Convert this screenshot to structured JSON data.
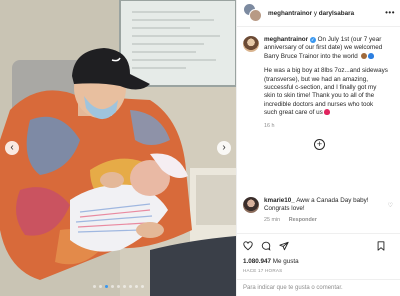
{
  "header": {
    "author1": "meghantrainor",
    "joiner": " y ",
    "author2": "darylsabara",
    "more_icon": "more-horizontal-icon"
  },
  "caption": {
    "username": "meghantrainor",
    "text1": " On July 1st (our 7 year anniversary of our first date) we welcomed Barry Bruce Trainor into the world ",
    "text2": "He was a big boy at 8lbs 7oz...and sideways (transverse), but we had an amazing, successful c-section, and I finally got my skin to skin time! Thank you to all of the incredible doctors and nurses who took such great care of us",
    "time": "16 h",
    "verified_icon": "verified-badge-icon"
  },
  "comment": {
    "username": "kmarie10_",
    "text": " Aww a Canada Day baby! Congrats love!",
    "time": "25 min",
    "reply": "Responder"
  },
  "stats": {
    "likes_value": "1.080.947",
    "likes_label": " Me gusta",
    "posted_ago": "HACE 17 HORAS"
  },
  "comment_bar": {
    "placeholder": "Para indicar que te gusta o comentar."
  },
  "carousel": {
    "slide_count": 9,
    "active_index": 2,
    "active_color": "#3897f0"
  },
  "colors": {
    "verified": "#3897f0",
    "text": "#262626",
    "secondary": "#8e8e8e"
  }
}
